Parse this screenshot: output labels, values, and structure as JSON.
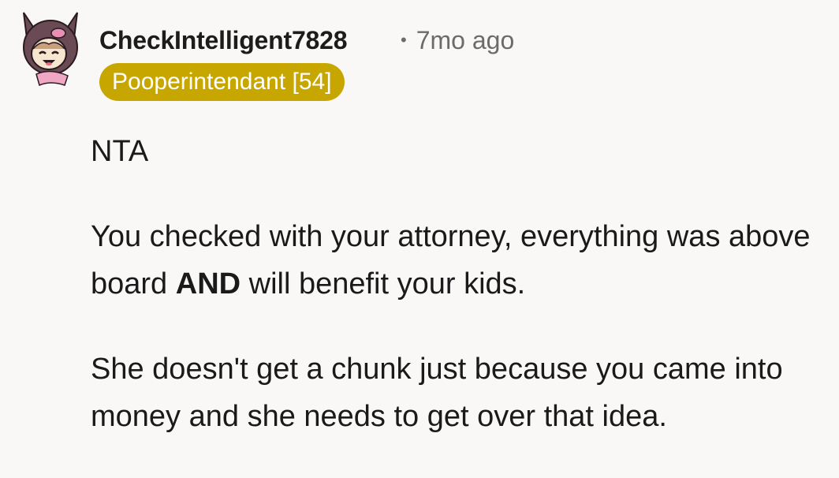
{
  "comment": {
    "username": "CheckIntelligent7828",
    "separator": "•",
    "timestamp": "7mo ago",
    "flair": "Pooperintendant [54]",
    "flair_color": "#c8a600",
    "avatar_icon": "cat-hood-avatar-icon",
    "paragraph1": "NTA",
    "paragraph2_before": "You checked with your attorney, everything was above board ",
    "paragraph2_bold": "AND",
    "paragraph2_after": " will benefit your kids.",
    "paragraph3": "She doesn't get a chunk just because you came into money and she needs to get over that idea."
  }
}
